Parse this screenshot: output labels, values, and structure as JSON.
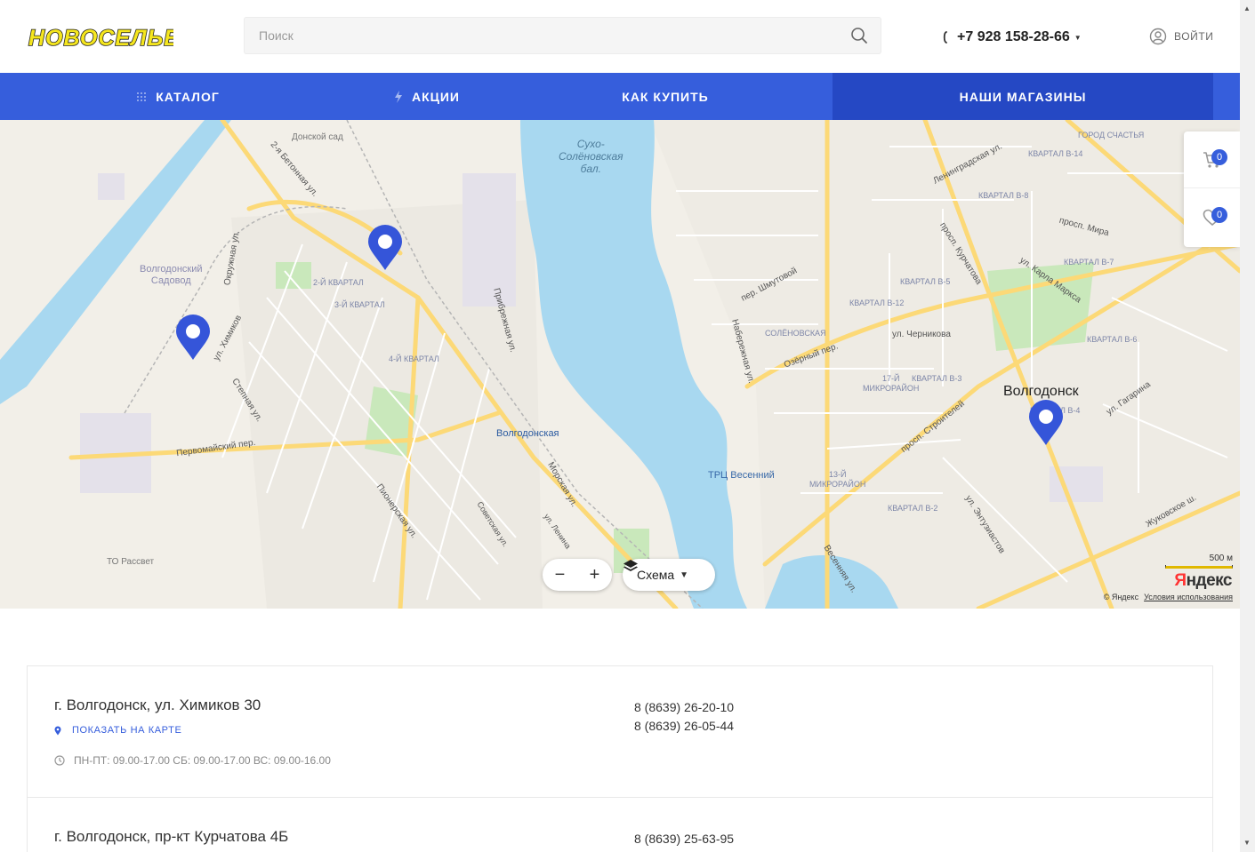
{
  "header": {
    "logo_text": "НОВОСЕЛЬЕ",
    "search_placeholder": "Поиск",
    "phone": "+7 928 158-28-66",
    "login_label": "ВОЙТИ"
  },
  "nav": {
    "items": [
      {
        "label": "КАТАЛОГ",
        "icon": "grid-icon"
      },
      {
        "label": "АКЦИИ",
        "icon": "lightning-icon"
      },
      {
        "label": "КАК КУПИТЬ"
      },
      {
        "label": "НАШИ МАГАЗИНЫ",
        "active": true
      }
    ]
  },
  "side": {
    "cart_count": "0",
    "favorites_count": "0"
  },
  "map": {
    "labels": {
      "city": "Волгодонск",
      "lake": "Сухо-\nСолёновская\nбал.",
      "station": "Волгодонская",
      "mall": "ТРЦ Весенний",
      "sadovod": "Волгодонский\nСадовод",
      "donskoy_sad": "Донской сад",
      "to_rassvet": "ТО Рассвет",
      "gorod_schastya": "ГОРОД СЧАСТЬЯ",
      "leningradskaya": "Ленинградская ул.",
      "kurchatova": "просп. Курчатова",
      "mira": "просп. Мира",
      "karla_marksa": "ул. Карла Маркса",
      "chernikova": "ул. Черникова",
      "stroiteley": "просп. Строителей",
      "zhukovskoe": "Жуковское ш.",
      "khimikov": "ул. Химиков",
      "stepnaya": "Степная ул.",
      "pervomayskiy": "Первомайский пер.",
      "morskaya": "Морская ул.",
      "pribrezhnaya": "Прибрежная ул.",
      "okruzhnaya": "Окружная ул.",
      "betonnaya": "2-я Бетонная ул.",
      "naberezhnaya": "Набережная ул.",
      "shumtovoy": "пер. Шмутовой",
      "ozerniy": "Озёрный пер.",
      "solenovskaya": "СОЛЁНОВСКАЯ",
      "mkr17": "17-Й\nМИКРОРАЙОН",
      "mkr13": "13-Й\nМИКРОРАЙОН",
      "kvartal_v2": "КВАРТАЛ В-2",
      "kvartal_v3": "КВАРТАЛ В-3",
      "kvartal_v4": "КВАРТАЛ В-4",
      "kvartal_v5": "КВАРТАЛ В-5",
      "kvartal_v8": "КВАРТАЛ В-8",
      "kvartal_v12": "КВАРТАЛ В-12",
      "kvartal_v14": "КВАРТАЛ В-14",
      "kvartal_v6": "КВАРТАЛ В-6",
      "kvartal_v7": "КВАРТАЛ В-7",
      "kvartal_2": "2-Й КВАРТАЛ",
      "kvartal_3": "3-Й КВАРТАЛ",
      "kvartal_4": "4-Й КВАРТАЛ",
      "entuziastov": "ул. Энтузиастов",
      "vesennyaya": "Весенняя ул.",
      "pionerskaya": "Пионерская ул.",
      "sovetskaya": "Советская ул.",
      "lenina": "ул. Ленина",
      "gagarina": "ул. Гагарина"
    },
    "zoom_minus": "−",
    "zoom_plus": "+",
    "layer_label": "Схема",
    "scale_label": "500 м",
    "attribution": "© Яндекс",
    "terms_link": "Условия использования",
    "brand_first": "Я",
    "brand_rest": "ндекс"
  },
  "stores": [
    {
      "address": "г. Волгодонск, ул. Химиков 30",
      "show_on_map": "ПОКАЗАТЬ НА КАРТЕ",
      "hours": "ПН-ПТ: 09.00-17.00 СБ: 09.00-17.00 ВС: 09.00-16.00",
      "phones": [
        "8 (8639) 26-20-10",
        "8 (8639) 26-05-44"
      ]
    },
    {
      "address": "г. Волгодонск, пр-кт Курчатова 4Б",
      "phones": [
        "8 (8639) 25-63-95"
      ]
    }
  ],
  "colors": {
    "accent": "#365edc",
    "nav_active": "#2548c4",
    "logo_yellow": "#f5e61e",
    "map_bg": "#f2efe8",
    "water": "#a8d8f0",
    "road": "#fcd977",
    "marker": "#3555d9"
  }
}
